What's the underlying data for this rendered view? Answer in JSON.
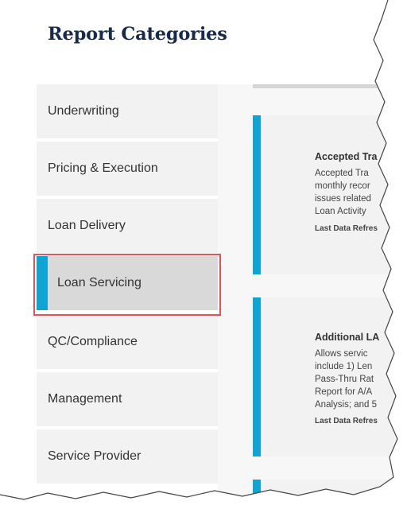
{
  "title": "Report Categories",
  "nav": [
    {
      "label": "Underwriting",
      "active": false
    },
    {
      "label": "Pricing & Execution",
      "active": false
    },
    {
      "label": "Loan Delivery",
      "active": false
    },
    {
      "label": "Loan Servicing",
      "active": true
    },
    {
      "label": "QC/Compliance",
      "active": false
    },
    {
      "label": "Management",
      "active": false
    },
    {
      "label": "Service Provider",
      "active": false
    }
  ],
  "cards": [
    {
      "title": "Accepted Tra",
      "desc": [
        "Accepted Tra",
        "monthly recor",
        "issues related",
        "Loan Activity"
      ],
      "refresh": "Last Data Refres"
    },
    {
      "title": "Additional LA",
      "desc": [
        "Allows servic",
        "include 1) Len",
        "Pass-Thru Rat",
        "Report for A/A",
        "Analysis; and 5"
      ],
      "refresh": "Last Data Refres"
    }
  ],
  "colors": {
    "accent": "#0ea4d4",
    "title": "#162a4c",
    "highlight": "#e0555a"
  }
}
